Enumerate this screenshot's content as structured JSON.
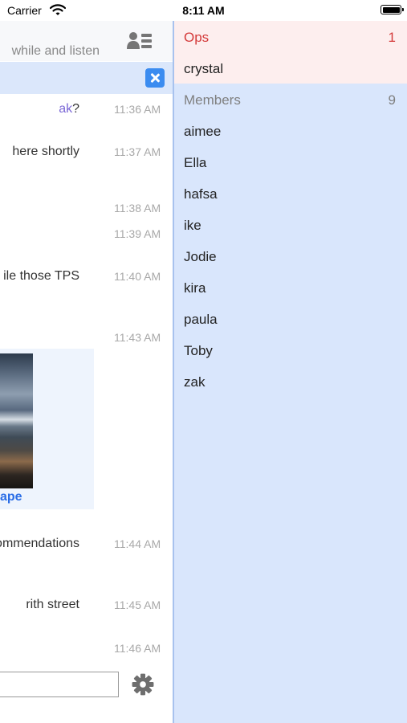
{
  "status_bar": {
    "carrier": "Carrier",
    "time": "8:11 AM"
  },
  "chat": {
    "topic": "while and listen",
    "messages": [
      {
        "nick": "ak",
        "text": "?",
        "time": "11:36 AM"
      },
      {
        "text": "here shortly",
        "time": "11:37 AM"
      },
      {
        "text": "",
        "time": "11:38 AM"
      },
      {
        "text": "",
        "time": "11:39 AM"
      },
      {
        "text": "ile those TPS",
        "time": "11:40 AM"
      },
      {
        "text": "",
        "time": "11:43 AM"
      },
      {
        "text": "ommendations",
        "time": "11:44 AM"
      },
      {
        "text": "rith street",
        "time": "11:45 AM"
      },
      {
        "text": "",
        "time": "11:46 AM"
      }
    ],
    "embed": {
      "caption": "ape"
    }
  },
  "members_panel": {
    "ops": {
      "label": "Ops",
      "count": "1",
      "color": "#d43a3a",
      "items": [
        "crystal"
      ]
    },
    "members": {
      "label": "Members",
      "count": "9",
      "items": [
        "aimee",
        "Ella",
        "hafsa",
        "ike",
        "Jodie",
        "kira",
        "paula",
        "Toby",
        "zak"
      ]
    }
  },
  "icons": {
    "wifi": "wifi-icon",
    "battery": "battery-icon",
    "members_toggle": "members-list-icon",
    "clear_search": "close-icon",
    "settings": "gear-icon"
  }
}
